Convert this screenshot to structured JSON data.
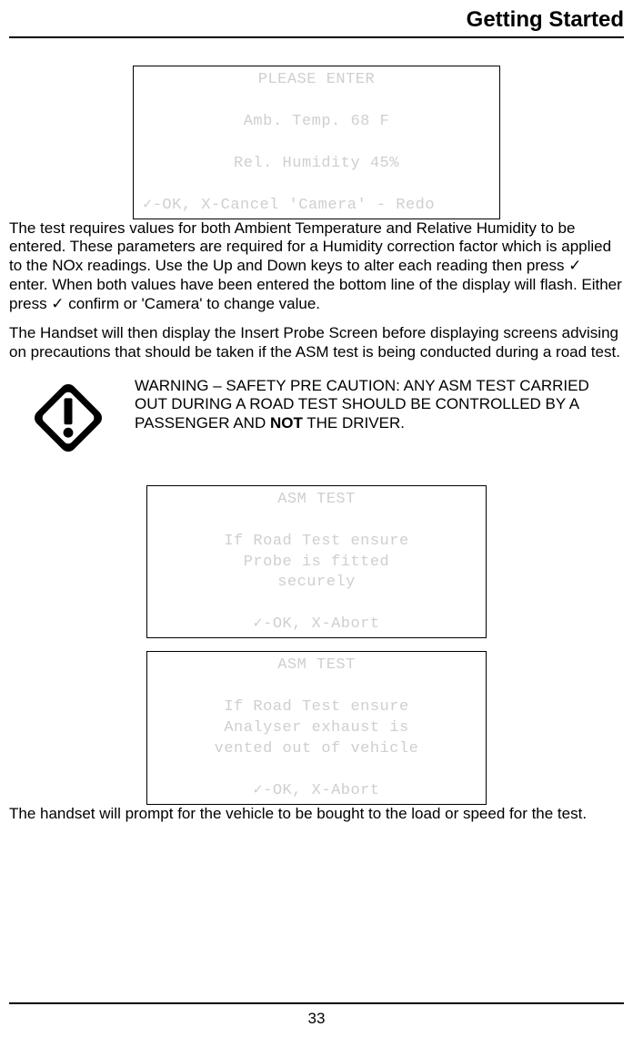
{
  "header": {
    "title": "Getting Started"
  },
  "page_number": "33",
  "lcd1": {
    "l1": "PLEASE ENTER",
    "l2": "Amb. Temp.   68 F",
    "l3": "Rel. Humidity 45%",
    "foot": "✓-OK, X-Cancel 'Camera' - Redo"
  },
  "para1": "The test requires values for both Ambient Temperature and Relative Humidity to be entered. These parameters are required for a Humidity correction factor which is applied to the NOx readings. Use the Up and Down keys to alter each reading then press ✓ enter. When both values have been entered the bottom line of the display will flash. Either press ✓  confirm or 'Camera' to change value.",
  "para2": "The Handset will then display the Insert Probe Screen before displaying screens advising on precautions that should be taken if the ASM test is being conducted during a road test.",
  "warning": {
    "pre": "WARNING – SAFETY PRE CAUTION: ANY ASM TEST CARRIED OUT DURING A ROAD TEST SHOULD BE CONTROLLED BY A PASSENGER AND ",
    "not": "NOT",
    "post": " THE DRIVER."
  },
  "lcd2": {
    "l1": "ASM TEST",
    "l2": "If Road Test ensure",
    "l3": "Probe is fitted",
    "l4": "securely",
    "foot": "✓-OK,    X-Abort"
  },
  "lcd3": {
    "l1": "ASM TEST",
    "l2": "If Road Test ensure",
    "l3": "Analyser exhaust is",
    "l4": "vented out of vehicle",
    "foot": "✓-OK,    X-Abort"
  },
  "para3": "The handset will prompt for the vehicle to be bought to the load or speed for the test."
}
